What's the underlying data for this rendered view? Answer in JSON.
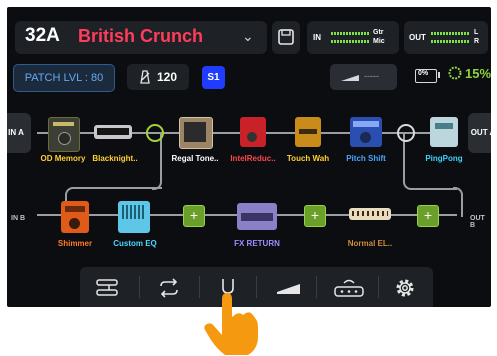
{
  "preset": {
    "number": "32A",
    "name": "British Crunch"
  },
  "meters": {
    "input": {
      "tag": "IN",
      "labels": [
        "Gtr",
        "Mic"
      ]
    },
    "output": {
      "tag": "OUT",
      "labels": [
        "L",
        "R"
      ]
    }
  },
  "status": {
    "patch_level": "PATCH LVL : 80",
    "tempo": "120",
    "snapshot": "S1",
    "expression_value": "-----",
    "battery": "0%",
    "cpu": "15%"
  },
  "io": {
    "in_a": "IN A",
    "out_a": "OUT A",
    "in_b": "IN B",
    "out_b": "OUT B"
  },
  "chain_a": [
    {
      "label": "OD Memory",
      "label_color": "#ffcf33"
    },
    {
      "label": "Blacknight..",
      "label_color": "#ffcf33"
    },
    {
      "label": "Regal Tone..",
      "label_color": "#ffffff"
    },
    {
      "label": "IntelReduc..",
      "label_color": "#ff4747"
    },
    {
      "label": "Touch Wah",
      "label_color": "#ffcf33"
    },
    {
      "label": "Pitch Shift",
      "label_color": "#4aa3ff"
    },
    {
      "label": "PingPong",
      "label_color": "#3fd2ff"
    }
  ],
  "chain_b": [
    {
      "label": "Shimmer",
      "label_color": "#ff7a2e"
    },
    {
      "label": "Custom EQ",
      "label_color": "#4ad7ff"
    },
    {
      "label": "FX RETURN",
      "label_color": "#a08cff"
    },
    {
      "label": "Normal EL..",
      "label_color": "#d18b3a"
    }
  ],
  "toolbar": [
    "signal-routing-icon",
    "loop-icon",
    "tuner-icon",
    "expression-pedal-icon",
    "footswitch-icon",
    "gear-icon"
  ],
  "colors": {
    "accent_red": "#ff3d5a",
    "accent_blue": "#1f3cff",
    "meter_green": "#7de242",
    "hand": "#f59a10"
  }
}
